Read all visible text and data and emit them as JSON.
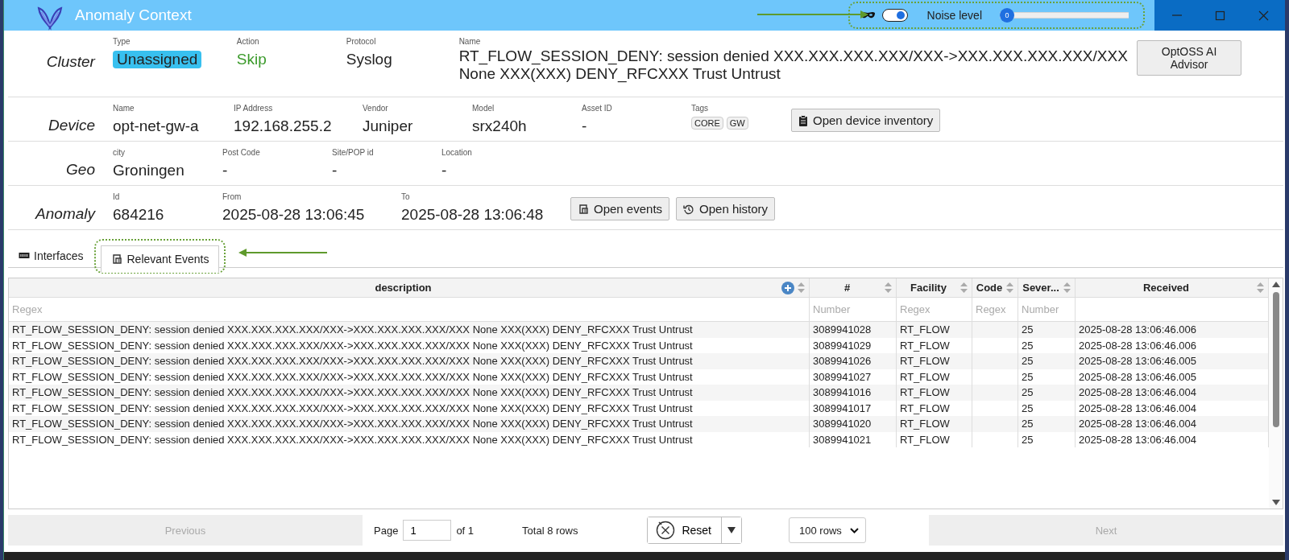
{
  "window": {
    "title": "Anomaly Context"
  },
  "noise": {
    "mask_toggle_on": true,
    "label": "Noise level",
    "level": 0,
    "value": "0"
  },
  "sections": [
    {
      "title": "Cluster",
      "fields": [
        {
          "label": "Type",
          "value": "Unassigned",
          "kind": "badge"
        },
        {
          "label": "Action",
          "value": "Skip",
          "kind": "positive"
        },
        {
          "label": "Protocol",
          "value": "Syslog",
          "kind": "plain"
        },
        {
          "label": "Name",
          "value": "RT_FLOW_SESSION_DENY: session denied XXX.XXX.XXX.XXX/XXX->XXX.XXX.XXX.XXX/XXX None XXX(XXX) DENY_RFCXXX Trust Untrust",
          "kind": "wide"
        }
      ],
      "buttons": [
        {
          "label": "OptOSS AI Advisor",
          "kind": "advisor"
        }
      ]
    },
    {
      "title": "Device",
      "fields": [
        {
          "label": "Name",
          "value": "opt-net-gw-a",
          "kind": "plain"
        },
        {
          "label": "IP Address",
          "value": "192.168.255.2",
          "kind": "plain"
        },
        {
          "label": "Vendor",
          "value": "Juniper",
          "kind": "plain"
        },
        {
          "label": "Model",
          "value": "srx240h",
          "kind": "plain"
        },
        {
          "label": "Asset ID",
          "value": "-",
          "kind": "plain"
        },
        {
          "label": "Tags",
          "tags": [
            "CORE",
            "GW"
          ],
          "kind": "tags"
        }
      ],
      "buttons": [
        {
          "label": "Open device inventory",
          "kind": "inventory"
        }
      ]
    },
    {
      "title": "Geo",
      "fields": [
        {
          "label": "city",
          "value": "Groningen",
          "kind": "plain"
        },
        {
          "label": "Post Code",
          "value": "-",
          "kind": "plain"
        },
        {
          "label": "Site/POP id",
          "value": "-",
          "kind": "plain"
        },
        {
          "label": "Location",
          "value": "-",
          "kind": "plain"
        }
      ]
    },
    {
      "title": "Anomaly",
      "fields": [
        {
          "label": "Id",
          "value": "684216",
          "kind": "plain"
        },
        {
          "label": "From",
          "value": "2025-08-28 13:06:45",
          "kind": "plain"
        },
        {
          "label": "To",
          "value": "2025-08-28 13:06:48",
          "kind": "plain"
        }
      ],
      "buttons": [
        {
          "label": "Open events",
          "kind": "events"
        },
        {
          "label": "Open history",
          "kind": "history"
        }
      ]
    }
  ],
  "tabs": [
    {
      "label": "Interfaces",
      "kind": "interfaces",
      "selected": false
    },
    {
      "label": "Relevant Events",
      "kind": "events",
      "selected": true
    }
  ],
  "table": {
    "columns": [
      {
        "label": "description",
        "placeholder": "Regex",
        "add_button": true
      },
      {
        "label": "#",
        "placeholder": "Number"
      },
      {
        "label": "Facility",
        "placeholder": "Regex"
      },
      {
        "label": "Code",
        "placeholder": "Regex"
      },
      {
        "label": "Sever...",
        "placeholder": "Number"
      },
      {
        "label": "Received"
      }
    ],
    "rows": [
      [
        "RT_FLOW_SESSION_DENY: session denied XXX.XXX.XXX.XXX/XXX->XXX.XXX.XXX.XXX/XXX None XXX(XXX) DENY_RFCXXX Trust Untrust",
        "3089941028",
        "RT_FLOW",
        "",
        "25",
        "2025-08-28 13:06:46.006"
      ],
      [
        "RT_FLOW_SESSION_DENY: session denied XXX.XXX.XXX.XXX/XXX->XXX.XXX.XXX.XXX/XXX None XXX(XXX) DENY_RFCXXX Trust Untrust",
        "3089941029",
        "RT_FLOW",
        "",
        "25",
        "2025-08-28 13:06:46.006"
      ],
      [
        "RT_FLOW_SESSION_DENY: session denied XXX.XXX.XXX.XXX/XXX->XXX.XXX.XXX.XXX/XXX None XXX(XXX) DENY_RFCXXX Trust Untrust",
        "3089941026",
        "RT_FLOW",
        "",
        "25",
        "2025-08-28 13:06:46.005"
      ],
      [
        "RT_FLOW_SESSION_DENY: session denied XXX.XXX.XXX.XXX/XXX->XXX.XXX.XXX.XXX/XXX None XXX(XXX) DENY_RFCXXX Trust Untrust",
        "3089941027",
        "RT_FLOW",
        "",
        "25",
        "2025-08-28 13:06:46.005"
      ],
      [
        "RT_FLOW_SESSION_DENY: session denied XXX.XXX.XXX.XXX/XXX->XXX.XXX.XXX.XXX/XXX None XXX(XXX) DENY_RFCXXX Trust Untrust",
        "3089941016",
        "RT_FLOW",
        "",
        "25",
        "2025-08-28 13:06:46.004"
      ],
      [
        "RT_FLOW_SESSION_DENY: session denied XXX.XXX.XXX.XXX/XXX->XXX.XXX.XXX.XXX/XXX None XXX(XXX) DENY_RFCXXX Trust Untrust",
        "3089941017",
        "RT_FLOW",
        "",
        "25",
        "2025-08-28 13:06:46.004"
      ],
      [
        "RT_FLOW_SESSION_DENY: session denied XXX.XXX.XXX.XXX/XXX->XXX.XXX.XXX.XXX/XXX None XXX(XXX) DENY_RFCXXX Trust Untrust",
        "3089941020",
        "RT_FLOW",
        "",
        "25",
        "2025-08-28 13:06:46.004"
      ],
      [
        "RT_FLOW_SESSION_DENY: session denied XXX.XXX.XXX.XXX/XXX->XXX.XXX.XXX.XXX/XXX None XXX(XXX) DENY_RFCXXX Trust Untrust",
        "3089941021",
        "RT_FLOW",
        "",
        "25",
        "2025-08-28 13:06:46.004"
      ]
    ]
  },
  "footer": {
    "previous": {
      "label": "Previous",
      "disabled": true
    },
    "page_label": "Page",
    "page": "1",
    "of": "of 1",
    "total": "Total 8 rows",
    "reset": "Reset",
    "rows_per_page": "100 rows",
    "next": {
      "label": "Next",
      "disabled": true
    }
  }
}
